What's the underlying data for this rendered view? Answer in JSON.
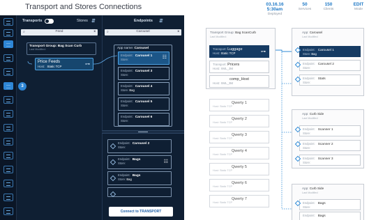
{
  "header": {
    "title": "Transport and Stores Connections",
    "stats": [
      {
        "value": "03.16.16 5:30am",
        "label": "Deployed"
      },
      {
        "value": "50",
        "label": "Services"
      },
      {
        "value": "150",
        "label": "Clients"
      },
      {
        "value": "EDIT",
        "label": "Mode"
      }
    ]
  },
  "sidebar": {
    "badge": "3"
  },
  "transports_panel": {
    "title": "Transports",
    "stores_label": "Stores",
    "search_value": "Feed",
    "search_clear": "x",
    "group": {
      "label": "Transport Group: Bag Scan Curb",
      "sub": "Last Modified:"
    },
    "selected": {
      "name": "Price Feeds",
      "host_label": "Host:",
      "host_value": "Static TCP"
    }
  },
  "endpoints_panel": {
    "title": "Endpoints",
    "search_value": "Carousel",
    "search_clear": "x",
    "app_label": "App name:",
    "app_name": "Carousel",
    "endpoint_label": "Endpoint:",
    "store_label": "Store:",
    "items": [
      {
        "name": "Carousel 1",
        "store": "",
        "selected": true
      },
      {
        "name": "Carousel 3",
        "store": ""
      },
      {
        "name": "Carousel 4",
        "store": "Bag"
      },
      {
        "name": "Carousel 5",
        "store": ""
      },
      {
        "name": "Carousel 6",
        "store": ""
      }
    ],
    "lower_items": [
      {
        "name": "Carousel 2",
        "store": ""
      },
      {
        "name": "Bags",
        "store": ""
      },
      {
        "name": "Bags",
        "store": "Bag"
      }
    ],
    "connect_button": "Connect to TRANSPORT"
  },
  "canvas": {
    "transport_group": {
      "label": "Transport Group:",
      "name": "Bag ScanCurb",
      "sub": "Last Modified:"
    },
    "transport_label": "Transport:",
    "host_label": "Host:",
    "transports": [
      {
        "name": "Luggage",
        "host": "Static TCP",
        "selected": true
      },
      {
        "name": "Pricers",
        "host": "XML_3M"
      },
      {
        "name": "comp_Host",
        "host": "XML_3M"
      }
    ],
    "qwerty": [
      {
        "name": "Qwerty 1",
        "host": "Static TCP"
      },
      {
        "name": "Qwerty 2",
        "host": "Static TCP"
      },
      {
        "name": "Qwerty 3",
        "host": "Static TCP"
      },
      {
        "name": "Qwerty 4",
        "host": "Static TCP"
      },
      {
        "name": "Qwerty 5",
        "host": "Static TCP"
      },
      {
        "name": "Qwerty 6",
        "host": "Static TCP"
      },
      {
        "name": "Qwerty 7",
        "host": "Static TCP"
      }
    ],
    "app_label": "App:",
    "sub_label": "Last Modified",
    "endpoint_label": "Endpoint:",
    "store_label": "Store:",
    "apps": [
      {
        "name": "Carousel",
        "endpoints": [
          {
            "name": "Carousel 1",
            "store": "Bag",
            "selected": true
          },
          {
            "name": "Carousel 2",
            "store": ""
          },
          {
            "name": "Stats",
            "store": ""
          }
        ]
      },
      {
        "name": "Curb Side",
        "endpoints": [
          {
            "name": "Scanner 1",
            "store": ""
          },
          {
            "name": "Scanner 2",
            "store": ""
          },
          {
            "name": "Scanner 3",
            "store": ""
          }
        ]
      },
      {
        "name": "Curb Side",
        "endpoints": [
          {
            "name": "Bags",
            "store": ""
          },
          {
            "name": "Bags",
            "store": ""
          }
        ]
      }
    ]
  }
}
